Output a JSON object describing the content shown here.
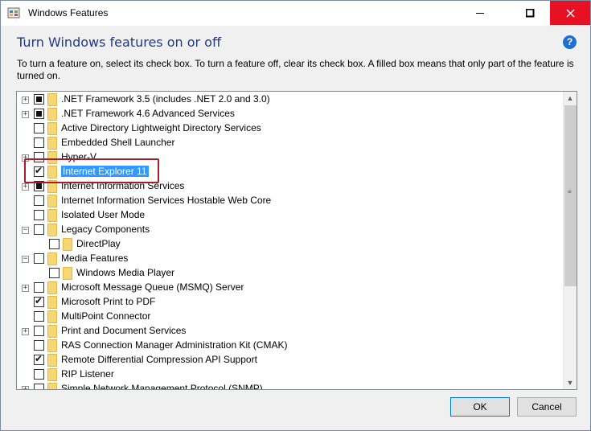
{
  "window": {
    "title": "Windows Features",
    "controls": {
      "minimize": "—",
      "maximize": "☐",
      "close": "✕"
    }
  },
  "heading": "Turn Windows features on or off",
  "help_glyph": "?",
  "description": "To turn a feature on, select its check box. To turn a feature off, clear its check box. A filled box means that only part of the feature is turned on.",
  "features": [
    {
      "label": ".NET Framework 3.5 (includes .NET 2.0 and 3.0)",
      "state": "partial",
      "expander": "+",
      "level": 0
    },
    {
      "label": ".NET Framework 4.6 Advanced Services",
      "state": "partial",
      "expander": "+",
      "level": 0
    },
    {
      "label": "Active Directory Lightweight Directory Services",
      "state": "unchecked",
      "expander": "",
      "level": 0
    },
    {
      "label": "Embedded Shell Launcher",
      "state": "unchecked",
      "expander": "",
      "level": 0
    },
    {
      "label": "Hyper-V",
      "state": "unchecked",
      "expander": "+",
      "level": 0
    },
    {
      "label": "Internet Explorer 11",
      "state": "checked",
      "expander": "",
      "level": 0,
      "selected": true
    },
    {
      "label": "Internet Information Services",
      "state": "partial",
      "expander": "+",
      "level": 0
    },
    {
      "label": "Internet Information Services Hostable Web Core",
      "state": "unchecked",
      "expander": "",
      "level": 0
    },
    {
      "label": "Isolated User Mode",
      "state": "unchecked",
      "expander": "",
      "level": 0
    },
    {
      "label": "Legacy Components",
      "state": "unchecked",
      "expander": "−",
      "level": 0
    },
    {
      "label": "DirectPlay",
      "state": "unchecked",
      "expander": "",
      "level": 1
    },
    {
      "label": "Media Features",
      "state": "unchecked",
      "expander": "−",
      "level": 0
    },
    {
      "label": "Windows Media Player",
      "state": "unchecked",
      "expander": "",
      "level": 1
    },
    {
      "label": "Microsoft Message Queue (MSMQ) Server",
      "state": "unchecked",
      "expander": "+",
      "level": 0
    },
    {
      "label": "Microsoft Print to PDF",
      "state": "checked",
      "expander": "",
      "level": 0
    },
    {
      "label": "MultiPoint Connector",
      "state": "unchecked",
      "expander": "",
      "level": 0
    },
    {
      "label": "Print and Document Services",
      "state": "unchecked",
      "expander": "+",
      "level": 0
    },
    {
      "label": "RAS Connection Manager Administration Kit (CMAK)",
      "state": "unchecked",
      "expander": "",
      "level": 0
    },
    {
      "label": "Remote Differential Compression API Support",
      "state": "checked",
      "expander": "",
      "level": 0
    },
    {
      "label": "RIP Listener",
      "state": "unchecked",
      "expander": "",
      "level": 0
    },
    {
      "label": "Simple Network Management Protocol (SNMP)",
      "state": "unchecked",
      "expander": "+",
      "level": 0
    }
  ],
  "buttons": {
    "ok": "OK",
    "cancel": "Cancel"
  },
  "colors": {
    "selection": "#3399ff",
    "highlight_box": "#a51d2d",
    "close_button": "#e81123",
    "heading": "#1e3a8a"
  }
}
